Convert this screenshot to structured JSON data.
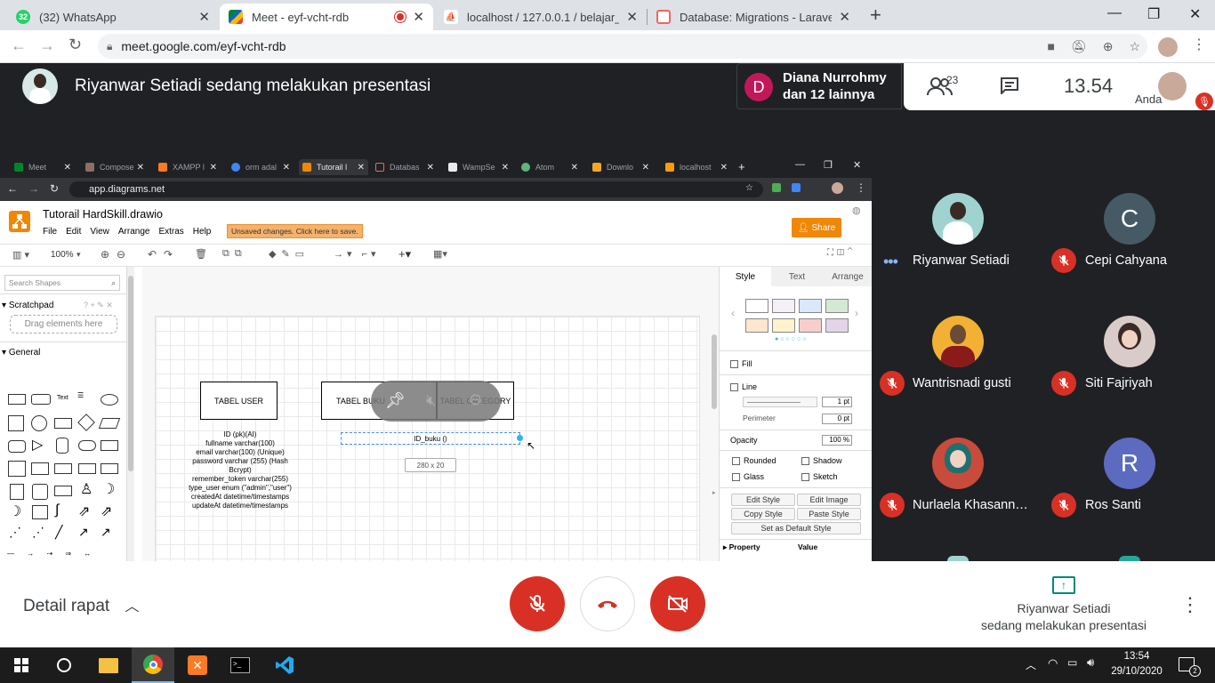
{
  "browser": {
    "tabs": [
      {
        "title": "(32) WhatsApp",
        "badge": "32"
      },
      {
        "title": "Meet - eyf-vcht-rdb"
      },
      {
        "title": "localhost / 127.0.0.1 / belajar_lara"
      },
      {
        "title": "Database: Migrations - Laravel - T"
      }
    ],
    "new_tab": "+",
    "url": "meet.google.com/eyf-vcht-rdb",
    "window": {
      "minimize": "—",
      "restore": "❐",
      "close": "✕"
    }
  },
  "meet": {
    "presenting_text": "Riyanwar Setiadi sedang melakukan presentasi",
    "joined": {
      "initial": "D",
      "line1": "Diana Nurrohmy",
      "line2": "dan 12 lainnya",
      "color": "#c2185b"
    },
    "participants_count": "23",
    "time": "13.54",
    "self_label": "Anda",
    "participants": [
      {
        "name": "Riyanwar Setiadi",
        "initial": "",
        "color": "#9fd3cf",
        "mic": "speaking"
      },
      {
        "name": "Cepi Cahyana",
        "initial": "C",
        "color": "#455a64",
        "mic": "off"
      },
      {
        "name": "Wantrisnadi gusti",
        "initial": "",
        "color": "#f2b134",
        "mic": "off"
      },
      {
        "name": "Siti Fajriyah",
        "initial": "",
        "color": "#d9cbc8",
        "mic": "off"
      },
      {
        "name": "Nurlaela Khasann…",
        "initial": "",
        "color": "#c94b3b",
        "mic": "off"
      },
      {
        "name": "Ros Santi",
        "initial": "R",
        "color": "#5c6bc0",
        "mic": "off"
      }
    ],
    "bottom": {
      "details": "Detail rapat",
      "presenting_line1": "Riyanwar Setiadi",
      "presenting_line2": "sedang melakukan presentasi"
    }
  },
  "shared": {
    "tabs": [
      "Meet",
      "Compose",
      "XAMPP l",
      "orm adal",
      "Tutorail l",
      "Databas",
      "WampSe",
      "Atom",
      "Downlo",
      "localhost"
    ],
    "url": "app.diagrams.net",
    "drawio": {
      "title": "Tutorail HardSkill.drawio",
      "menu": [
        "File",
        "Edit",
        "View",
        "Arrange",
        "Extras",
        "Help"
      ],
      "unsaved": "Unsaved changes. Click here to save.",
      "share": "Share",
      "zoom": "100%",
      "search_placeholder": "Search Shapes",
      "scratchpad": "Scratchpad",
      "drag_here": "Drag elements here",
      "general": "General",
      "diagram": {
        "box1": "TABEL USER",
        "box2": "TABEL BUKU",
        "box3": "TABEL CATEGORY",
        "user_fields": [
          "ID (pk)(AI)",
          "fullname varchar(100)",
          "email varchar(100) (Unique)",
          "password varchar (255) (Hash",
          "Bcrypt)",
          "remember_token varchar(255)",
          "type_user enum (\"admin\",\"user\")",
          "createdAt datetime/timestamps",
          "updateAt datetime/timestamps"
        ],
        "selected_text": "ID_buku ()",
        "size_label": "280 x 20"
      },
      "panel": {
        "tabs": [
          "Style",
          "Text",
          "Arrange"
        ],
        "fill": "Fill",
        "line": "Line",
        "line_width": "1 pt",
        "perimeter": "Perimeter",
        "perimeter_value": "0 pt",
        "opacity": "Opacity",
        "opacity_value": "100 %",
        "rounded": "Rounded",
        "shadow": "Shadow",
        "glass": "Glass",
        "sketch": "Sketch",
        "edit_style": "Edit Style",
        "edit_image": "Edit Image",
        "copy_style": "Copy Style",
        "paste_style": "Paste Style",
        "default_style": "Set as Default Style",
        "property": "Property",
        "value": "Value",
        "swatches": [
          "#ffffff",
          "#f5f0f7",
          "#dae8fc",
          "#d5e8d4",
          "#ffe6cc",
          "#fff2cc",
          "#f8cecc",
          "#e1d5e7"
        ]
      }
    }
  },
  "taskbar": {
    "time": "13:54",
    "date": "29/10/2020",
    "notifications": "2"
  }
}
